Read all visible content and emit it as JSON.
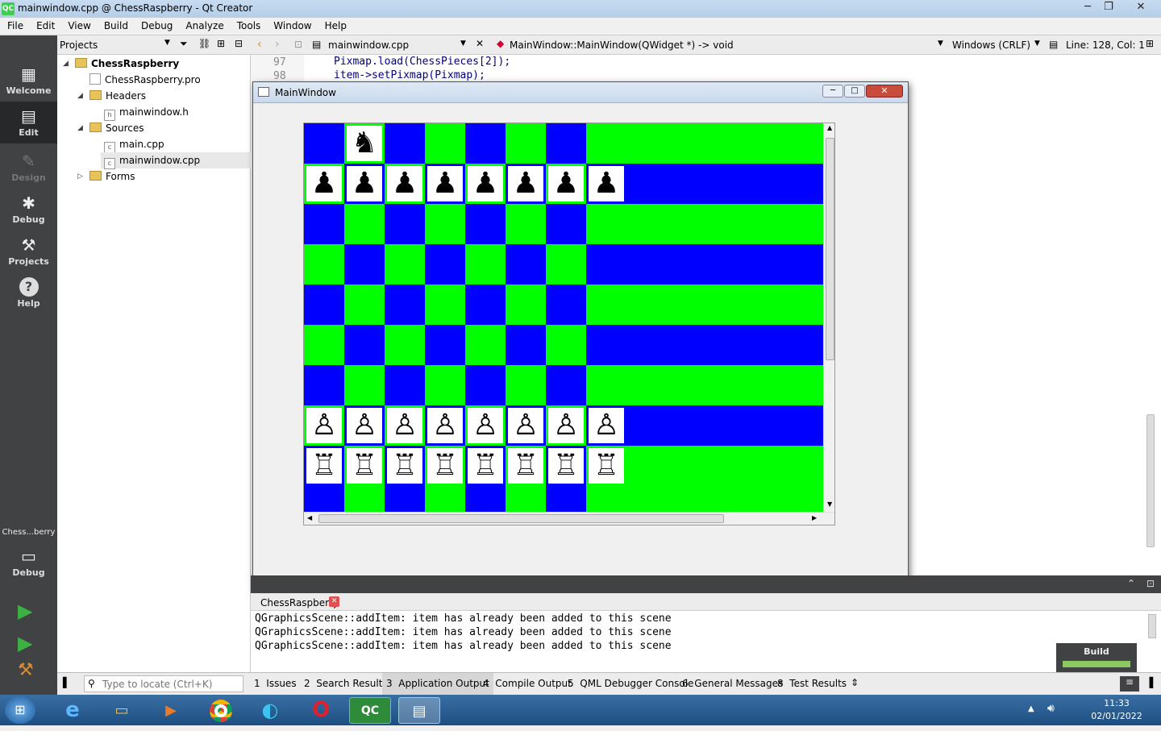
{
  "window": {
    "title": "mainwindow.cpp @ ChessRaspberry - Qt Creator",
    "app_badge": "QC"
  },
  "menu": [
    "File",
    "Edit",
    "View",
    "Build",
    "Debug",
    "Analyze",
    "Tools",
    "Window",
    "Help"
  ],
  "modes": {
    "welcome": "Welcome",
    "edit": "Edit",
    "design": "Design",
    "debug": "Debug",
    "projects": "Projects",
    "help": "Help",
    "kit": "Chess...berry",
    "kit_mode": "Debug"
  },
  "projects": {
    "header": "Projects",
    "tree": {
      "root": "ChessRaspberry",
      "pro": "ChessRaspberry.pro",
      "headers": "Headers",
      "mainwindow_h": "mainwindow.h",
      "sources": "Sources",
      "main_cpp": "main.cpp",
      "mainwindow_cpp": "mainwindow.cpp",
      "forms": "Forms"
    }
  },
  "editor": {
    "file": "mainwindow.cpp",
    "symbol": "MainWindow::MainWindow(QWidget *) -> void",
    "line_ending": "Windows (CRLF)",
    "position": "Line: 128, Col: 1",
    "lines": [
      {
        "num": "97",
        "code": "Pixmap.load(ChessPieces[2]);"
      },
      {
        "num": "98",
        "code": "item->setPixmap(Pixmap);"
      }
    ]
  },
  "mainwindow": {
    "title": "MainWindow"
  },
  "board": {
    "rows": 9,
    "cols": 8,
    "colors": {
      "a": "#0000ff",
      "b": "#00ff00",
      "piece_bg": "#ffffff"
    },
    "pieces": {
      "black_knight": "♞",
      "black_pawn": "♟",
      "white_pawn": "♙",
      "white_rook": "♖"
    }
  },
  "output": {
    "tab": "ChessRaspberry",
    "lines": [
      "QGraphicsScene::addItem: item has already been added to this scene",
      "QGraphicsScene::addItem: item has already been added to this scene",
      "QGraphicsScene::addItem: item has already been added to this scene"
    ],
    "build_label": "Build"
  },
  "statusbar": {
    "locate_placeholder": "Type to locate (Ctrl+K)",
    "tabs": [
      {
        "n": "1",
        "label": "Issues"
      },
      {
        "n": "2",
        "label": "Search Results"
      },
      {
        "n": "3",
        "label": "Application Output"
      },
      {
        "n": "4",
        "label": "Compile Output"
      },
      {
        "n": "5",
        "label": "QML Debugger Console"
      },
      {
        "n": "6",
        "label": "General Messages"
      },
      {
        "n": "8",
        "label": "Test Results"
      }
    ]
  },
  "taskbar": {
    "time": "11:33",
    "date": "02/01/2022",
    "qc": "QC"
  }
}
